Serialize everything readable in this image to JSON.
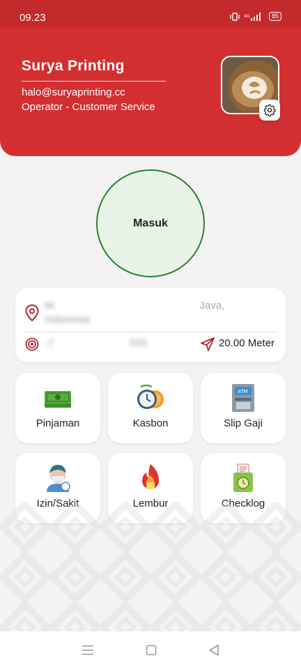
{
  "status_bar": {
    "time": "09.23",
    "battery": "85"
  },
  "profile": {
    "name": "Surya Printing",
    "email": "halo@suryaprinting.cc",
    "role": "Operator - Customer Service"
  },
  "checkin": {
    "label": "Masuk"
  },
  "location": {
    "address_line1": "W",
    "address_line1_end": "Java,",
    "address_line2": "Indonesia",
    "coordinates": "-7",
    "coordinates_end": "533",
    "distance": "20.00 Meter"
  },
  "menu": [
    {
      "label": "Pinjaman",
      "icon": "money-icon"
    },
    {
      "label": "Kasbon",
      "icon": "clock-coin-icon"
    },
    {
      "label": "Slip Gaji",
      "icon": "atm-icon"
    },
    {
      "label": "Izin/Sakit",
      "icon": "sick-person-icon"
    },
    {
      "label": "Lembur",
      "icon": "fire-icon"
    },
    {
      "label": "Checklog",
      "icon": "checklog-icon"
    }
  ],
  "colors": {
    "primary": "#d32f30",
    "checkin_border": "#2e7d32",
    "checkin_fill": "#e8f5e6",
    "background": "#f3f3f3"
  }
}
